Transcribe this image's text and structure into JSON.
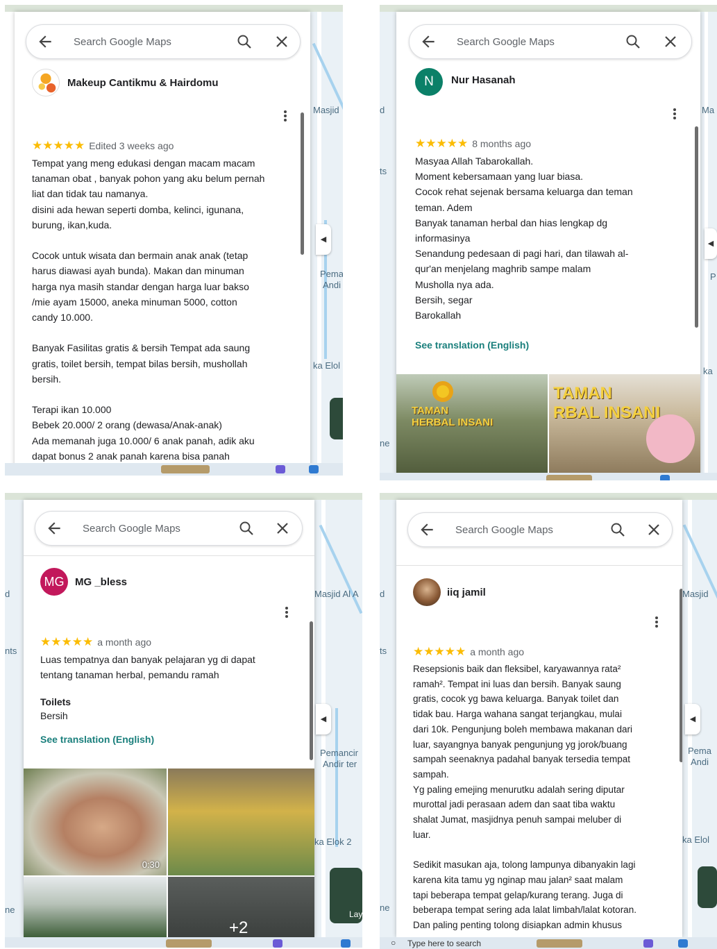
{
  "search": {
    "placeholder": "Search Google Maps"
  },
  "quads": {
    "q1": {
      "user": "Makeup Cantikmu & Hairdomu",
      "stars": "★★★★★",
      "time": "Edited 3 weeks ago",
      "body": "Tempat yang meng edukasi dengan macam macam\ntanaman obat , banyak pohon yang aku belum pernah\nliat dan tidak tau namanya.\ndisini  ada hewan seperti domba, kelinci, igunana,\nburung, ikan,kuda.\n\nCocok untuk wisata dan bermain anak anak (tetap\nharus diawasi ayah bunda). Makan dan minuman\nharga nya masih standar dengan harga luar bakso\n/mie ayam 15000, aneka minuman 5000, cotton\ncandy 10.000.\n\nBanyak Fasilitas gratis & bersih Tempat ada saung\ngratis, toilet bersih, tempat bilas bersih, mushollah\nbersih.\n\nTerapi ikan 10.000\nBebek 20.000/ 2 orang (dewasa/Anak-anak)\nAda memanah juga 10.000/ 6 anak panah, adik aku\ndapat bonus 2 anak panah karena bisa panah",
      "map_labels": [
        "Masjid",
        "Pema",
        "Andi",
        "ka Elol"
      ]
    },
    "q2": {
      "avatar": "N",
      "user": "Nur Hasanah",
      "stars": "★★★★★",
      "time": "8 months ago",
      "body": "Masyaa Allah Tabarokallah.\nMoment kebersamaan yang luar biasa.\nCocok rehat sejenak bersama keluarga dan teman\nteman. Adem\nBanyak tanaman herbal dan hias lengkap dg\ninformasinya\nSenandung pedesaan di pagi hari, dan tilawah al-\nqur'an menjelang maghrib sampe malam\nMusholla nya ada.\nBersih, segar\nBarokallah",
      "translate": "See translation (English)",
      "photo_text_1": "TAMAN\nHERBAL INSANI",
      "photo_text_2": "TAMAN\nRBAL INSANI",
      "map_labels": [
        "Ma",
        "P",
        "ka"
      ],
      "left_labels": [
        "d",
        "ts",
        "ne"
      ]
    },
    "q3": {
      "avatar": "MG",
      "user": "MG _bless",
      "stars": "★★★★★",
      "time": "a month ago",
      "body": "Luas tempatnya dan banyak pelajaran yg di dapat\ntentang tanaman herbal, pemandu ramah",
      "toilets_label": "Toilets",
      "toilets_value": "Bersih",
      "translate": "See translation (English)",
      "video_duration": "0:30",
      "more_photos": "+2",
      "map_labels": [
        "Masjid Al A",
        "Pemancir",
        "Andir ter",
        "ka Elok 2",
        "Lay"
      ],
      "left_labels": [
        "d",
        "nts",
        "ne"
      ]
    },
    "q4": {
      "user": "iiq jamil",
      "stars": "★★★★★",
      "time": "a month ago",
      "body": "Resepsionis baik dan fleksibel, karyawannya rata²\nramah². Tempat ini luas dan bersih. Banyak saung\ngratis, cocok yg bawa keluarga. Banyak toilet dan\ntidak bau. Harga wahana sangat terjangkau, mulai\ndari 10k. Pengunjung boleh membawa makanan dari\nluar, sayangnya banyak pengunjung yg jorok/buang\nsampah seenaknya padahal banyak tersedia tempat\nsampah.\nYg paling emejing menurutku adalah sering diputar\nmurottal jadi perasaan adem dan saat tiba waktu\nshalat Jumat, masjidnya penuh sampai meluber di\nluar.\n\nSedikit masukan aja, tolong lampunya dibanyakin lagi\nkarena kita tamu yg nginap mau jalan² saat malam\ntapi beberapa tempat gelap/kurang terang. Juga di\nbeberapa tempat sering ada lalat limbah/lalat kotoran.\nDan paling penting tolong disiapkan admin khusus",
      "map_labels": [
        "Masjid",
        "Pema",
        "Andi",
        "ka Elol"
      ],
      "left_labels": [
        "d",
        "ts",
        "ne"
      ],
      "taskbar_search": "Type here to search"
    }
  },
  "colors": {
    "star": "#fbbc04",
    "translate": "#1a7f7c",
    "avatar_n": "#0b8068",
    "avatar_mg": "#c2185b"
  }
}
